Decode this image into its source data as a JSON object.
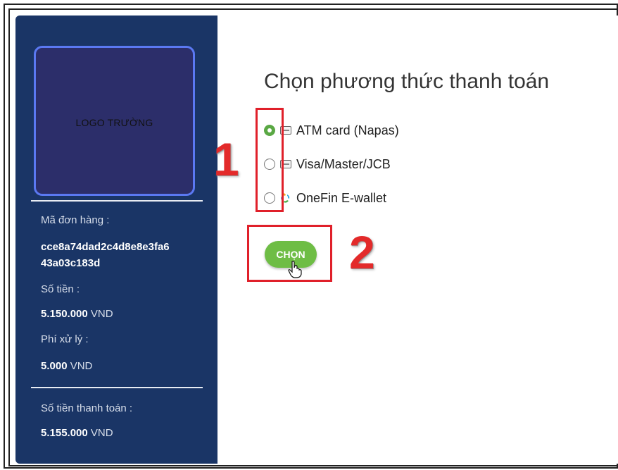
{
  "sidebar": {
    "logo_text": "LOGO TRƯỜNG",
    "order_label": "Mã đơn hàng :",
    "order_id_line1": "cce8a74dad2c4d8e8e3fa6",
    "order_id_line2": "43a03c183d",
    "amount_label": "Số tiền :",
    "amount_value": "5.150.000",
    "fee_label": "Phí xử lý :",
    "fee_value": "5.000",
    "total_label": "Số tiền thanh toán :",
    "total_value": "5.155.000",
    "currency": "VND"
  },
  "main": {
    "title": "Chọn phương thức thanh toán",
    "options": [
      {
        "label": "ATM card (Napas)",
        "icon": "atm-card-icon",
        "selected": true
      },
      {
        "label": "Visa/Master/JCB",
        "icon": "credit-card-icon",
        "selected": false
      },
      {
        "label": "OneFin E-wallet",
        "icon": "onefin-logo-icon",
        "selected": false
      }
    ],
    "button_label": "CHỌN"
  },
  "annotations": {
    "step1": "1",
    "step2": "2",
    "color": "#e32a2a"
  },
  "colors": {
    "sidebar_bg": "#1a3566",
    "accent_green": "#6ebd45"
  }
}
